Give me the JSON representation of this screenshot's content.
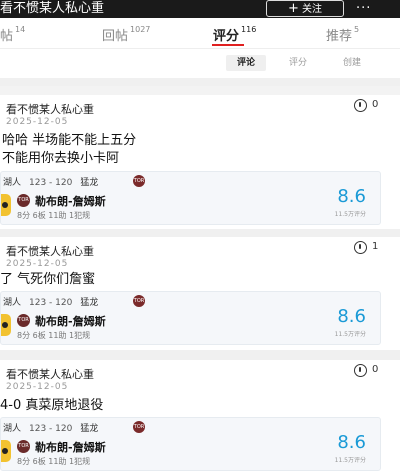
{
  "topbar": {
    "title": "看不惯某人私心重",
    "follow_label": "关注",
    "more_label": "···"
  },
  "tabs": [
    {
      "label": "主帖",
      "count": "14"
    },
    {
      "label": "回帖",
      "count": "1027"
    },
    {
      "label": "评分",
      "count": "116",
      "active": true
    },
    {
      "label": "推荐",
      "count": "5"
    }
  ],
  "subtabs": [
    {
      "label": "评论",
      "active": true
    },
    {
      "label": "评分"
    },
    {
      "label": "创建"
    }
  ],
  "cards": [
    {
      "user": "看不惯某人私心重",
      "date": "2025-12-05",
      "count": "0",
      "lines": [
        "哈哈 半场能不能上五分",
        "不能用你去换小卡阿"
      ],
      "game": {
        "home": "湖人",
        "score": "123 - 120",
        "away": "猛龙",
        "away_logo": "TOR",
        "player_badge": "TOR",
        "player": "勒布朗-詹姆斯",
        "stats": "8分  6板  11助  1犯规",
        "rating": "8.6",
        "rating_sub": "11.5万评分"
      }
    },
    {
      "user": "看不惯某人私心重",
      "date": "2025-12-05",
      "count": "1",
      "lines": [
        "了 气死你们詹蜜"
      ],
      "game": {
        "home": "湖人",
        "score": "123 - 120",
        "away": "猛龙",
        "away_logo": "TOR",
        "player_badge": "TOR",
        "player": "勒布朗-詹姆斯",
        "stats": "8分  6板  11助  1犯规",
        "rating": "8.6",
        "rating_sub": "11.5万评分"
      }
    },
    {
      "user": "看不惯某人私心重",
      "date": "2025-12-05",
      "count": "0",
      "lines": [
        "4-0 真菜原地退役"
      ],
      "game": {
        "home": "湖人",
        "score": "123 - 120",
        "away": "猛龙",
        "away_logo": "TOR",
        "player_badge": "TOR",
        "player": "勒布朗-詹姆斯",
        "stats": "8分  6板  11助  1犯规",
        "rating": "8.6",
        "rating_sub": "11.5万评分"
      }
    }
  ]
}
